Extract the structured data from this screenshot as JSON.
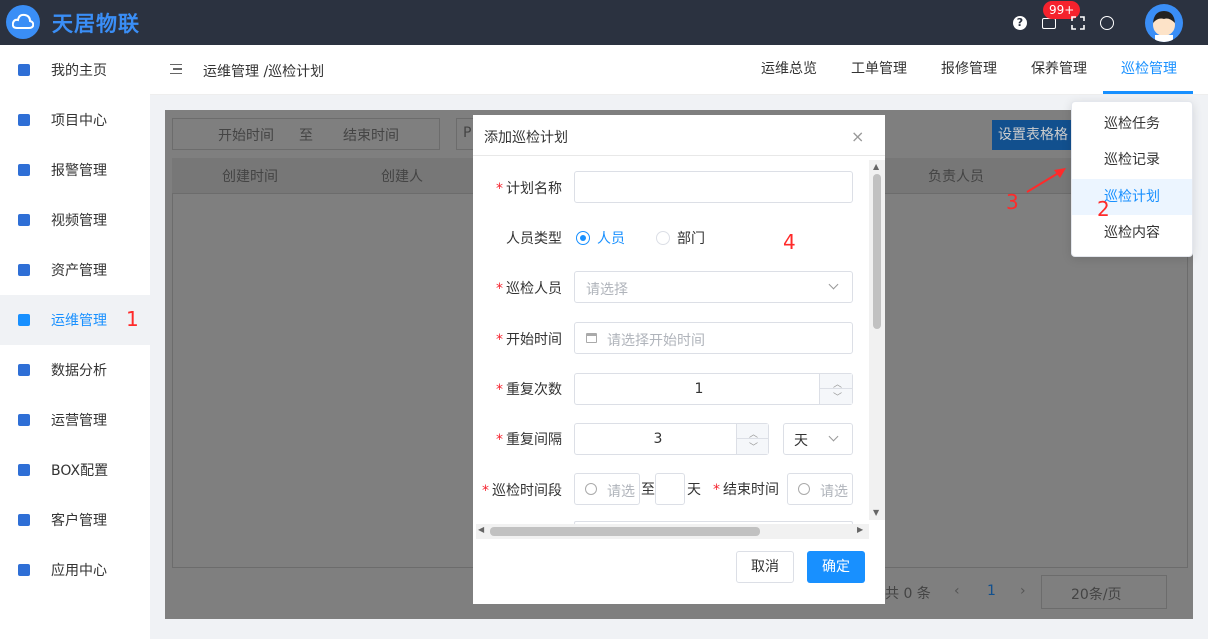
{
  "app": {
    "brand": "天居物联"
  },
  "topbar": {
    "help_icon": "?",
    "notification_count": "99+"
  },
  "sidebar": {
    "items": [
      {
        "label": "我的主页",
        "icon": "home-icon"
      },
      {
        "label": "项目中心",
        "icon": "project-icon"
      },
      {
        "label": "报警管理",
        "icon": "bell-icon"
      },
      {
        "label": "视频管理",
        "icon": "video-icon"
      },
      {
        "label": "资产管理",
        "icon": "asset-icon"
      },
      {
        "label": "运维管理",
        "icon": "gear-icon",
        "active": true
      },
      {
        "label": "数据分析",
        "icon": "monitor-icon"
      },
      {
        "label": "运营管理",
        "icon": "shield-icon"
      },
      {
        "label": "BOX配置",
        "icon": "box-icon"
      },
      {
        "label": "客户管理",
        "icon": "users-icon"
      },
      {
        "label": "应用中心",
        "icon": "apps-icon"
      }
    ]
  },
  "header": {
    "breadcrumb": "运维管理 /巡检计划",
    "tabs": [
      {
        "label": "运维总览"
      },
      {
        "label": "工单管理"
      },
      {
        "label": "报修管理"
      },
      {
        "label": "保养管理"
      },
      {
        "label": "巡检管理",
        "active": true
      }
    ]
  },
  "dropdown": {
    "items": [
      {
        "label": "巡检任务"
      },
      {
        "label": "巡检记录"
      },
      {
        "label": "巡检计划",
        "active": true
      },
      {
        "label": "巡检内容"
      }
    ]
  },
  "background": {
    "start_placeholder": "开始时间",
    "range_separator": "至",
    "end_placeholder": "结束时间",
    "partial_input": "P",
    "settings_button": "设置表格格",
    "columns": [
      "创建时间",
      "创建人",
      "负责人员"
    ],
    "total": "共 0 条",
    "page": "1",
    "page_size": "20条/页"
  },
  "annotations": {
    "a1": "1",
    "a2": "2",
    "a3": "3",
    "a4": "4"
  },
  "dialog": {
    "title": "添加巡检计划",
    "close_icon": "×",
    "plan_name_label": "计划名称",
    "person_type_label": "人员类型",
    "person_type_options": [
      "人员",
      "部门"
    ],
    "inspector_label": "巡检人员",
    "inspector_placeholder": "请选择",
    "start_time_label": "开始时间",
    "start_time_placeholder": "请选择开始时间",
    "repeat_count_label": "重复次数",
    "repeat_count_value": "1",
    "repeat_interval_label": "重复间隔",
    "repeat_interval_value": "3",
    "interval_unit": "天",
    "time_period_label": "巡检时间段",
    "period_start_placeholder": "请选",
    "period_separator": "至",
    "period_day_unit": "天",
    "end_time_label": "结束时间",
    "end_time_placeholder": "请选",
    "cancel_label": "取消",
    "confirm_label": "确定"
  }
}
